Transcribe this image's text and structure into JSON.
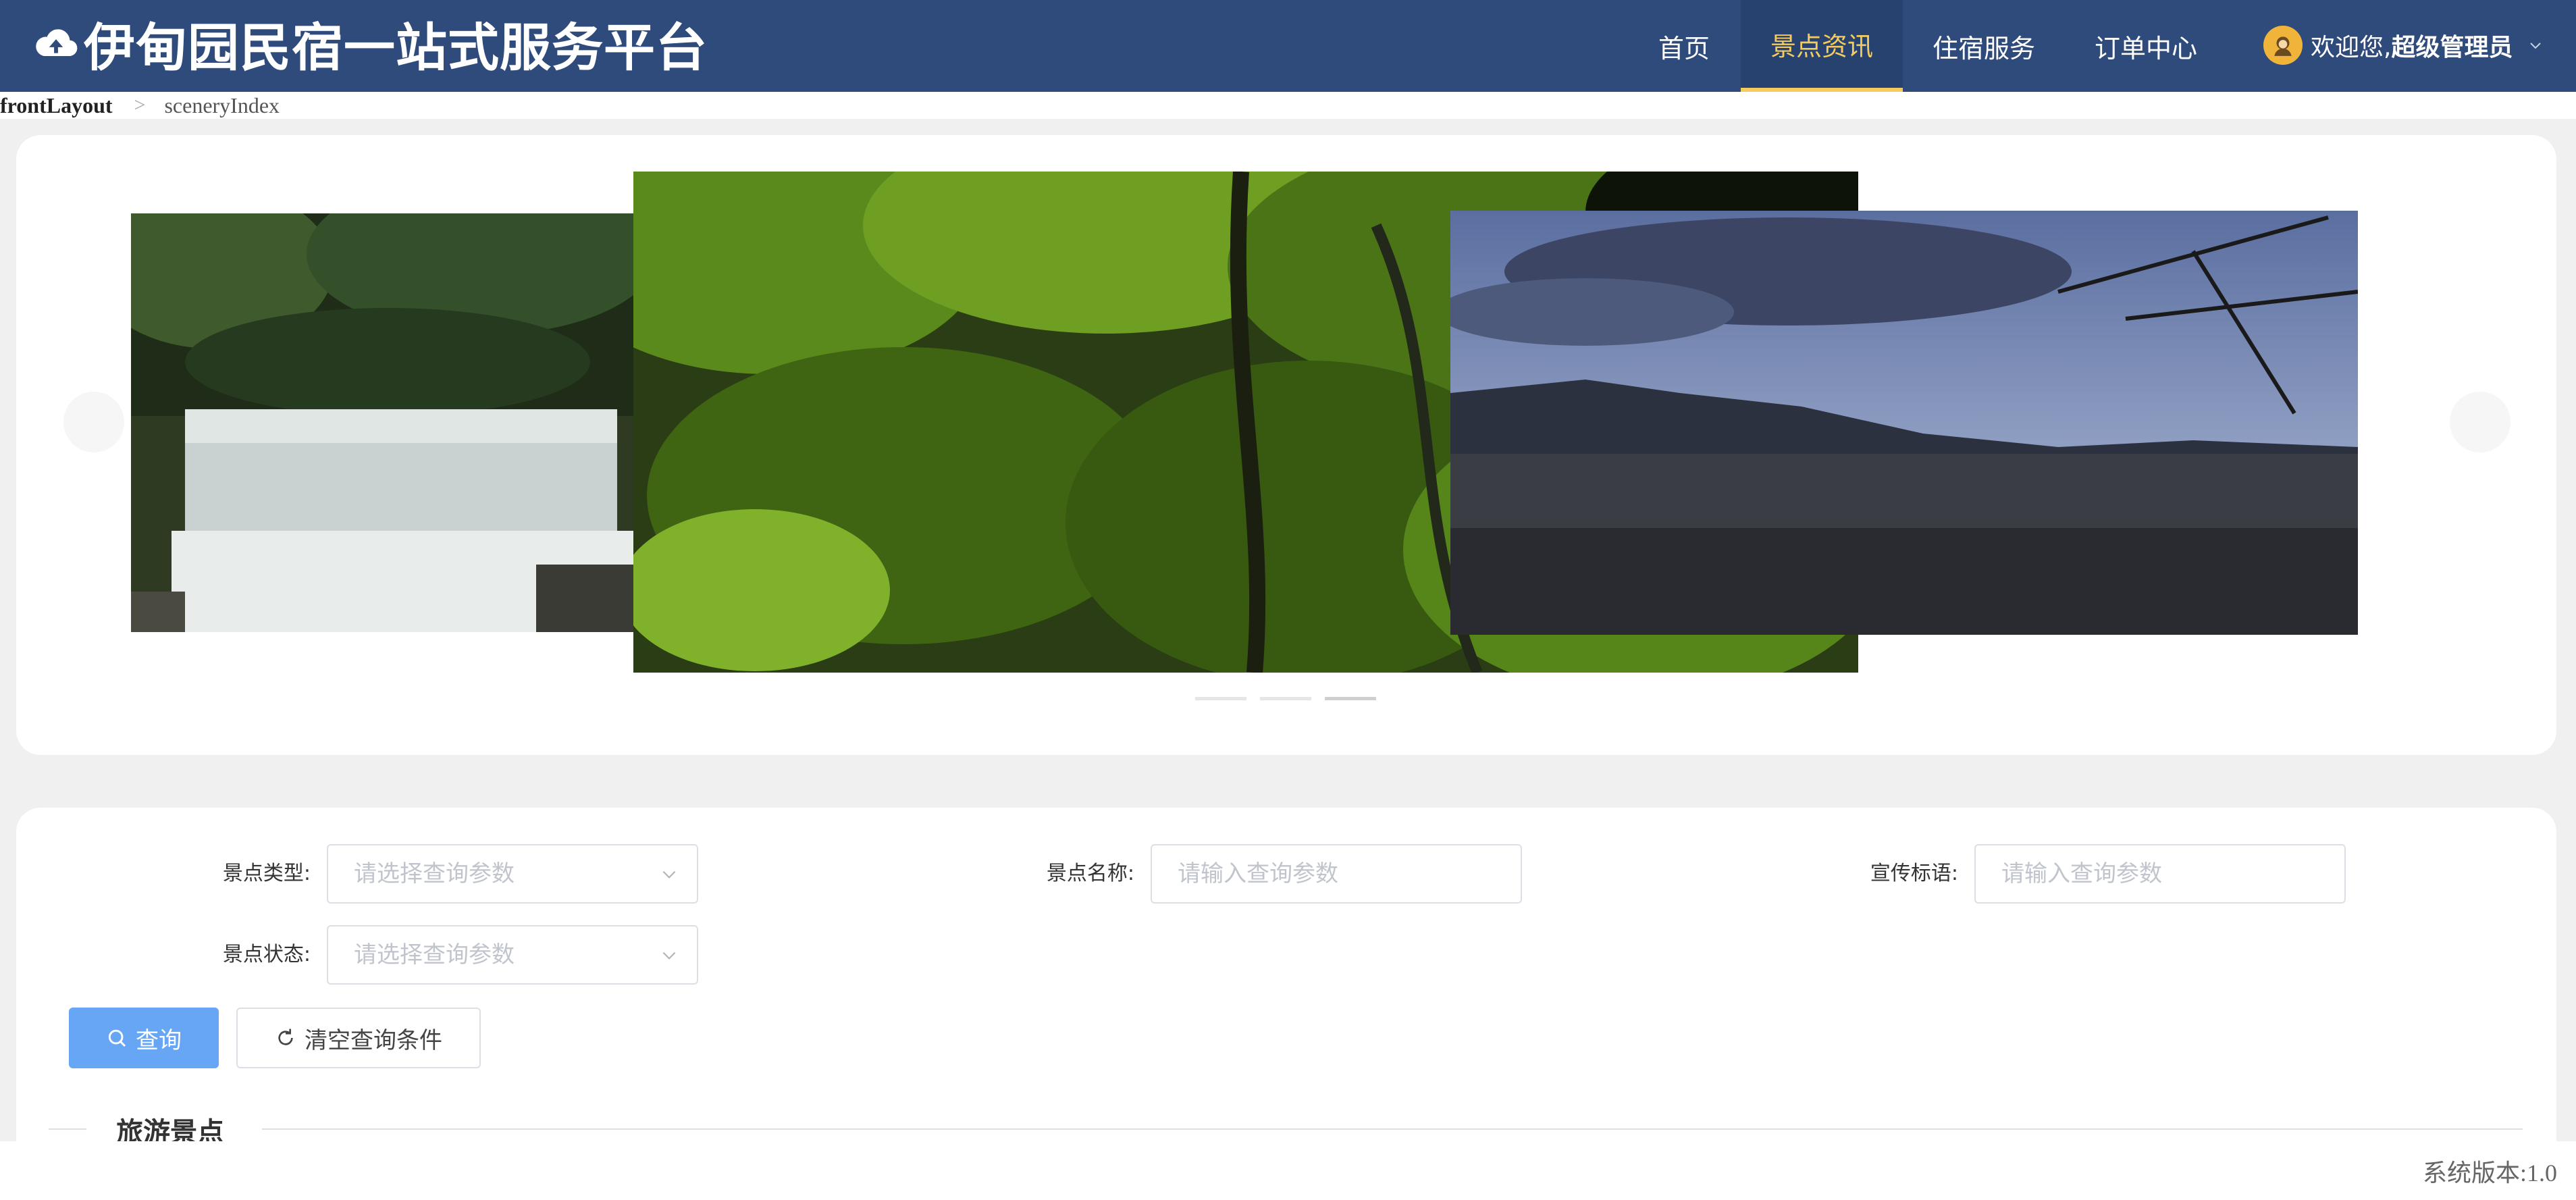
{
  "header": {
    "app_title": "伊甸园民宿一站式服务平台",
    "nav": [
      {
        "label": "首页"
      },
      {
        "label": "景点资讯"
      },
      {
        "label": "住宿服务"
      },
      {
        "label": "订单中心"
      }
    ],
    "active_nav": "景点资讯",
    "user": {
      "greeting": "欢迎您,",
      "name": "超级管理员"
    }
  },
  "breadcrumb": [
    "frontLayout",
    "sceneryIndex"
  ],
  "carousel": {
    "slides": [
      {
        "subject": "waterfall"
      },
      {
        "subject": "rainforest"
      },
      {
        "subject": "old town at dusk"
      }
    ],
    "indicator_count": 3,
    "active_indicator": 3
  },
  "search": {
    "fields": [
      {
        "label": "景点类型:",
        "placeholder": "请选择查询参数",
        "type": "select"
      },
      {
        "label": "景点名称:",
        "placeholder": "请输入查询参数",
        "type": "input"
      },
      {
        "label": "宣传标语:",
        "placeholder": "请输入查询参数",
        "type": "input"
      },
      {
        "label": "景点状态:",
        "placeholder": "请选择查询参数",
        "type": "select"
      }
    ],
    "query_button": "查询",
    "clear_button": "清空查询条件"
  },
  "section": {
    "title": "旅游景点"
  },
  "footer": {
    "version": "系统版本:1.0"
  },
  "colors": {
    "header_bg": "#2f4b7c",
    "active_nav": "#f3cb5e",
    "primary_button": "#66a6f5"
  },
  "icons": [
    "cloud-upload-icon",
    "avatar-icon",
    "chevron-down-icon",
    "search-icon",
    "refresh-icon"
  ]
}
